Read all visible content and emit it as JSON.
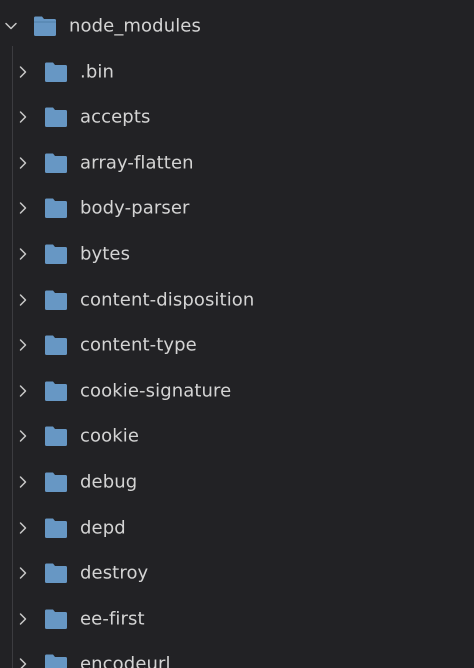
{
  "theme": {
    "background": "#222225",
    "text": "#d4d4d4",
    "folder_color": "#6797c4",
    "chevron_color": "#c8c8c8"
  },
  "root": {
    "label": "node_modules",
    "expanded": true,
    "icon": "folder-icon",
    "chevron": "chevron-down-icon"
  },
  "children": [
    {
      "label": ".bin",
      "expanded": false
    },
    {
      "label": "accepts",
      "expanded": false
    },
    {
      "label": "array-flatten",
      "expanded": false
    },
    {
      "label": "body-parser",
      "expanded": false
    },
    {
      "label": "bytes",
      "expanded": false
    },
    {
      "label": "content-disposition",
      "expanded": false
    },
    {
      "label": "content-type",
      "expanded": false
    },
    {
      "label": "cookie-signature",
      "expanded": false
    },
    {
      "label": "cookie",
      "expanded": false
    },
    {
      "label": "debug",
      "expanded": false
    },
    {
      "label": "depd",
      "expanded": false
    },
    {
      "label": "destroy",
      "expanded": false
    },
    {
      "label": "ee-first",
      "expanded": false
    },
    {
      "label": "encodeurl",
      "expanded": false
    }
  ]
}
